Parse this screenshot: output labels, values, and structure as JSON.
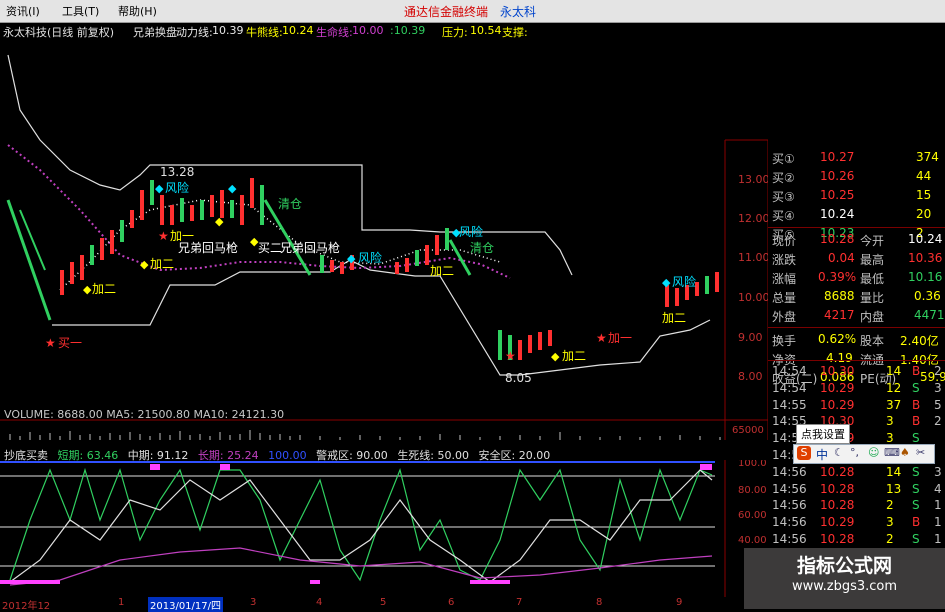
{
  "menu": {
    "items": [
      "资讯(I)",
      "工具(T)",
      "帮助(H)"
    ],
    "brand": "通达信金融终端",
    "brand_right": "永太科"
  },
  "info": {
    "stock": "永太科技(日线 前复权)",
    "formula": "兄弟换盘",
    "dongli_label": "动力线:",
    "dongli_value": "10.39",
    "niuxiong_label": "牛熊线:",
    "niuxiong_value": "10.24",
    "shengming_label": "生命线:",
    "shengming_value": "10.00",
    "extra_value": ":10.39",
    "yali_label": "压力:",
    "yali_value": "10.54",
    "zhicheng_label": "支撑:"
  },
  "price_axis": [
    "13.00",
    "12.00",
    "11.00",
    "10.00",
    "9.00",
    "8.00"
  ],
  "annotations": {
    "high": "13.28",
    "low": "8.05",
    "fengxian": "风险",
    "qingcang": "清仓",
    "jia_yi": "加一",
    "jia_er": "加二",
    "mai_yi": "买一",
    "mai_er": "买二",
    "xiongdi": "兄弟回马枪"
  },
  "volume": {
    "label": "VOLUME: 8688.00 MA5: 21500.80 MA10: 24121.30",
    "axis": "65000"
  },
  "indicator": {
    "name": "抄底买卖",
    "short_label": "短期: 63.46",
    "mid_label": "中期: 91.12",
    "long_label": "长期: 25.24",
    "extra": "100.00",
    "warn_label": "警戒区: 90.00",
    "life_label": "生死线: 50.00",
    "safe_label": "安全区: 20.00",
    "axis": [
      "100.0",
      "80.00",
      "60.00",
      "40.00",
      "20.00"
    ]
  },
  "quote_panel": {
    "bids": [
      {
        "label": "买①",
        "price": "10.27",
        "vol": "374"
      },
      {
        "label": "买②",
        "price": "10.26",
        "vol": "44"
      },
      {
        "label": "买③",
        "price": "10.25",
        "vol": "15"
      },
      {
        "label": "买④",
        "price": "10.24",
        "vol": "20"
      },
      {
        "label": "买⑤",
        "price": "10.23",
        "vol": "2"
      }
    ],
    "stats": [
      {
        "l1": "现价",
        "v1": "10.28",
        "l2": "今开",
        "v2": "10.24"
      },
      {
        "l1": "涨跌",
        "v1": "0.04",
        "l2": "最高",
        "v2": "10.36"
      },
      {
        "l1": "涨幅",
        "v1": "0.39%",
        "l2": "最低",
        "v2": "10.16"
      },
      {
        "l1": "总量",
        "v1": "8688",
        "l2": "量比",
        "v2": "0.36"
      },
      {
        "l1": "外盘",
        "v1": "4217",
        "l2": "内盘",
        "v2": "4471"
      },
      {
        "l1": "换手",
        "v1": "0.62%",
        "l2": "股本",
        "v2": "2.40亿"
      },
      {
        "l1": "净资",
        "v1": "4.19",
        "l2": "流通",
        "v2": "1.40亿"
      },
      {
        "l1": "收益(二)",
        "v1": "0.086",
        "l2": "PE(动)",
        "v2": "59.9"
      }
    ],
    "ticks": [
      {
        "time": "14:54",
        "price": "10.30",
        "vol": "14",
        "side": "B",
        "n": "2"
      },
      {
        "time": "14:54",
        "price": "10.29",
        "vol": "12",
        "side": "S",
        "n": "3"
      },
      {
        "time": "14:55",
        "price": "10.29",
        "vol": "37",
        "side": "B",
        "n": "5"
      },
      {
        "time": "14:55",
        "price": "10.30",
        "vol": "3",
        "side": "B",
        "n": "2"
      },
      {
        "time": "14:55",
        "price": "10.29",
        "vol": "3",
        "side": "S",
        "n": ""
      },
      {
        "time": "14:56",
        "price": "10.30",
        "vol": "",
        "side": "",
        "n": ""
      },
      {
        "time": "14:56",
        "price": "10.28",
        "vol": "14",
        "side": "S",
        "n": "3"
      },
      {
        "time": "14:56",
        "price": "10.28",
        "vol": "13",
        "side": "S",
        "n": "4"
      },
      {
        "time": "14:56",
        "price": "10.28",
        "vol": "2",
        "side": "S",
        "n": "1"
      },
      {
        "time": "14:56",
        "price": "10.29",
        "vol": "3",
        "side": "B",
        "n": "1"
      },
      {
        "time": "14:56",
        "price": "10.28",
        "vol": "2",
        "side": "S",
        "n": "1"
      }
    ]
  },
  "toolbar": {
    "tooltip": "点我设置",
    "logo": "S",
    "mode": "中"
  },
  "watermark": {
    "line1": "指标公式网",
    "line2": "www.zbgs3.com"
  },
  "bottom_axis": {
    "labels": [
      "2012年12",
      "1",
      "2013/01/17/四",
      "3",
      "4",
      "5",
      "6",
      "7",
      "8",
      "9",
      "10"
    ]
  },
  "colors": {
    "up": "#ff3030",
    "down": "#30d060",
    "cyan": "#00e0ff",
    "yellow": "#ffff00",
    "magenta": "#c040c0",
    "white": "#e0e0e0"
  }
}
